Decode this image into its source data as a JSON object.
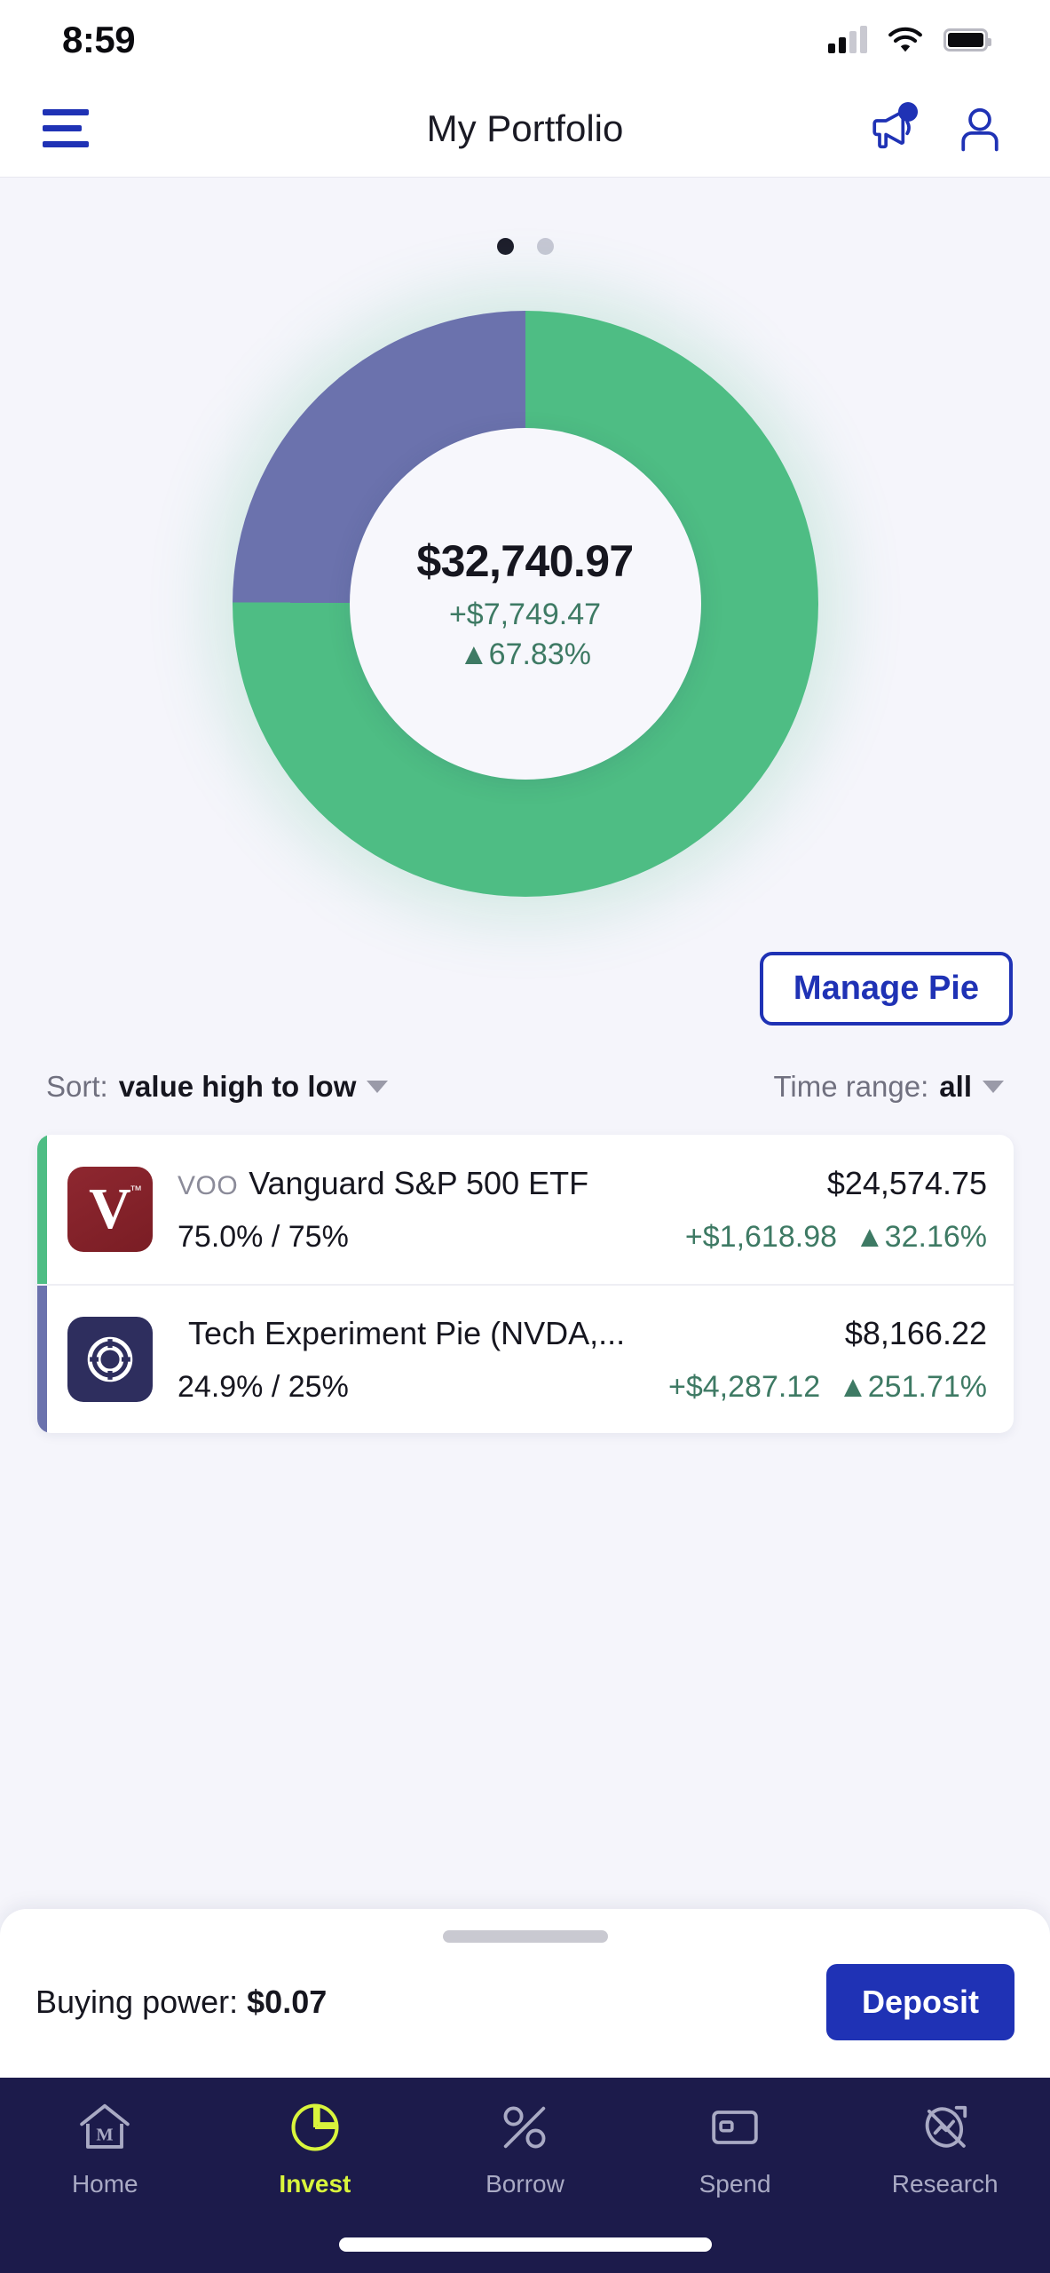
{
  "status_bar": {
    "time": "8:59",
    "cellular_icon": "signal-bars-icon",
    "wifi_icon": "wifi-icon",
    "battery_icon": "battery-icon"
  },
  "header": {
    "menu_icon": "hamburger-menu-icon",
    "title": "My Portfolio",
    "announcements_icon": "megaphone-icon",
    "profile_icon": "person-icon",
    "accent_color": "#1F32B5"
  },
  "pager": {
    "total": 2,
    "active_index": 0
  },
  "portfolio": {
    "total_value": "$32,740.97",
    "total_gain": "+$7,749.47",
    "total_gain_percent": "▲67.83%",
    "gain_color": "#3E7A64",
    "manage_button": "Manage Pie"
  },
  "chart_data": {
    "type": "pie",
    "title": "My Portfolio",
    "labels": [
      "Vanguard S&P 500 ETF",
      "Tech Experiment Pie (NVDA,..."
    ],
    "values": [
      75.0,
      24.9
    ],
    "targets": [
      75,
      25
    ],
    "amounts": [
      24574.75,
      8166.22
    ],
    "colors": [
      "#4EBD84",
      "#6B72AD"
    ],
    "center_label": "$32,740.97",
    "center_sub": "+$7,749.47",
    "center_sub2": "▲67.83%",
    "donut": true,
    "hole_ratio": 0.6,
    "legend": "none",
    "start_angle": 0
  },
  "controls": {
    "sort_label": "Sort:",
    "sort_value": "value high to low",
    "time_label": "Time range:",
    "time_value": "all"
  },
  "holdings": [
    {
      "accent_color": "#4EBD84",
      "logo": "vanguard-logo",
      "logo_letter": "V",
      "logo_tm": "™",
      "ticker": "VOO",
      "name": "Vanguard S&P 500 ETF",
      "value": "$24,574.75",
      "weights": "75.0% / 75%",
      "gain": "+$1,618.98",
      "gain_percent": "▲32.16%"
    },
    {
      "accent_color": "#6B72AD",
      "logo": "pie-slice-logo",
      "logo_letter": "",
      "logo_tm": "",
      "ticker": "",
      "name": "Tech Experiment Pie (NVDA,...",
      "value": "$8,166.22",
      "weights": "24.9% / 25%",
      "gain": "+$4,287.12",
      "gain_percent": "▲251.71%"
    }
  ],
  "bottom_sheet": {
    "grab_handle": "drag-handle",
    "buying_power_label": "Buying power:",
    "buying_power_value": "$0.07",
    "deposit_button": "Deposit"
  },
  "bottom_nav": {
    "active_color": "#D9F53C",
    "inactive_color": "#A9AAC4",
    "background": "#1C1B4B",
    "items": [
      {
        "label": "Home",
        "icon": "house-m-icon",
        "active": false
      },
      {
        "label": "Invest",
        "icon": "pie-chart-icon",
        "active": true
      },
      {
        "label": "Borrow",
        "icon": "percent-icon",
        "active": false
      },
      {
        "label": "Spend",
        "icon": "card-icon",
        "active": false
      },
      {
        "label": "Research",
        "icon": "trend-circle-icon",
        "active": false
      }
    ]
  }
}
